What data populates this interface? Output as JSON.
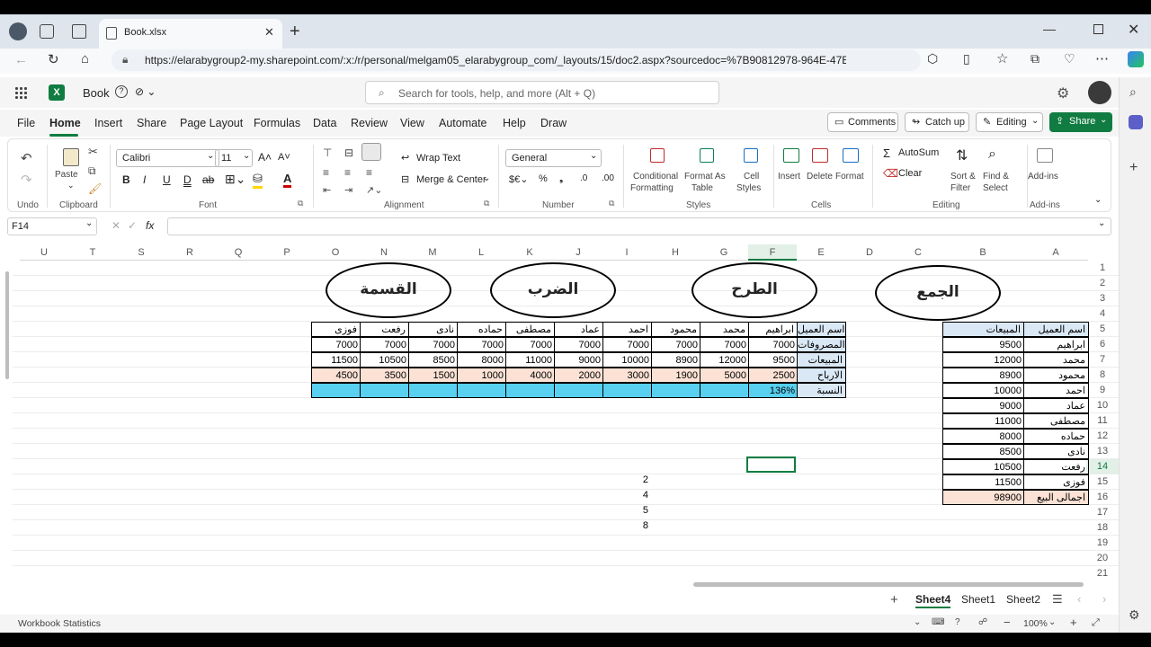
{
  "browser": {
    "tab_title": "Book.xlsx",
    "url": "https://elarabygroup2-my.sharepoint.com/:x:/r/personal/melgam05_elarabygroup_com/_layouts/15/doc2.aspx?sourcedoc=%7B90812978-964E-47E..."
  },
  "app": {
    "doc_name": "Book",
    "search_placeholder": "Search for tools, help, and more (Alt + Q)"
  },
  "menu": [
    "File",
    "Home",
    "Insert",
    "Share",
    "Page Layout",
    "Formulas",
    "Data",
    "Review",
    "View",
    "Automate",
    "Help",
    "Draw"
  ],
  "actions": {
    "comments": "Comments",
    "catchup": "Catch up",
    "editing": "Editing",
    "share": "Share"
  },
  "ribbon": {
    "undo_group": "Undo",
    "paste": "Paste",
    "clipboard_group": "Clipboard",
    "font_name": "Calibri",
    "font_size": "11",
    "font_group": "Font",
    "wrap_text": "Wrap Text",
    "merge_center": "Merge & Center",
    "alignment_group": "Alignment",
    "number_format": "General",
    "number_group": "Number",
    "cond_format_1": "Conditional",
    "cond_format_2": "Formatting",
    "format_table_1": "Format As",
    "format_table_2": "Table",
    "cell_styles_1": "Cell",
    "cell_styles_2": "Styles",
    "styles_group": "Styles",
    "insert": "Insert",
    "delete": "Delete",
    "format": "Format",
    "cells_group": "Cells",
    "autosum": "AutoSum",
    "clear": "Clear",
    "sort_1": "Sort &",
    "sort_2": "Filter",
    "find_1": "Find &",
    "find_2": "Select",
    "editing_group": "Editing",
    "addins": "Add-ins",
    "addins_group": "Add-ins"
  },
  "formula_bar": {
    "name_box": "F14",
    "formula": ""
  },
  "columns": [
    "U",
    "T",
    "S",
    "R",
    "Q",
    "P",
    "O",
    "N",
    "M",
    "L",
    "K",
    "J",
    "I",
    "H",
    "G",
    "F",
    "E",
    "D",
    "C",
    "B",
    "A"
  ],
  "rows": [
    "1",
    "2",
    "3",
    "4",
    "5",
    "6",
    "7",
    "8",
    "9",
    "10",
    "11",
    "12",
    "13",
    "14",
    "15",
    "16",
    "17",
    "18",
    "19",
    "20",
    "21"
  ],
  "ovals": {
    "sum": "الجمع",
    "subtract": "الطرح",
    "multiply": "الضرب",
    "divide": "القسمة"
  },
  "customer_table": {
    "headers": [
      "اسم العميل",
      "المبيعات"
    ],
    "rows": [
      [
        "ابراهيم",
        "9500"
      ],
      [
        "محمد",
        "12000"
      ],
      [
        "محمود",
        "8900"
      ],
      [
        "احمد",
        "10000"
      ],
      [
        "عماد",
        "9000"
      ],
      [
        "مصطفى",
        "11000"
      ],
      [
        "حماده",
        "8000"
      ],
      [
        "نادى",
        "8500"
      ],
      [
        "رفعت",
        "10500"
      ],
      [
        "فوزى",
        "11500"
      ]
    ],
    "total_label": "اجمالى البيع",
    "total_value": "98900"
  },
  "calc_table": {
    "labels": [
      "اسم العميل",
      "المصروفات",
      "المبيعات",
      "الارباح",
      "النسبة"
    ],
    "names": [
      "ابراهيم",
      "محمد",
      "محمود",
      "احمد",
      "عماد",
      "مصطفى",
      "حماده",
      "نادى",
      "رفعت",
      "فوزى"
    ],
    "expenses": [
      "7000",
      "7000",
      "7000",
      "7000",
      "7000",
      "7000",
      "7000",
      "7000",
      "7000",
      "7000"
    ],
    "sales": [
      "9500",
      "12000",
      "8900",
      "10000",
      "9000",
      "11000",
      "8000",
      "8500",
      "10500",
      "11500"
    ],
    "profits": [
      "2500",
      "5000",
      "1900",
      "3000",
      "2000",
      "4000",
      "1000",
      "1500",
      "3500",
      "4500"
    ],
    "ratio_first": "136%"
  },
  "loose_values": [
    "2",
    "4",
    "5",
    "8"
  ],
  "sheets": [
    "Sheet4",
    "Sheet1",
    "Sheet2"
  ],
  "status": {
    "left": "Workbook Statistics",
    "zoom": "100%"
  },
  "colors": {
    "excel_green": "#107c41",
    "header_blue": "#dae8f5",
    "ratio_cyan": "#59d0ef",
    "profit_peach": "#fbe2d5"
  }
}
